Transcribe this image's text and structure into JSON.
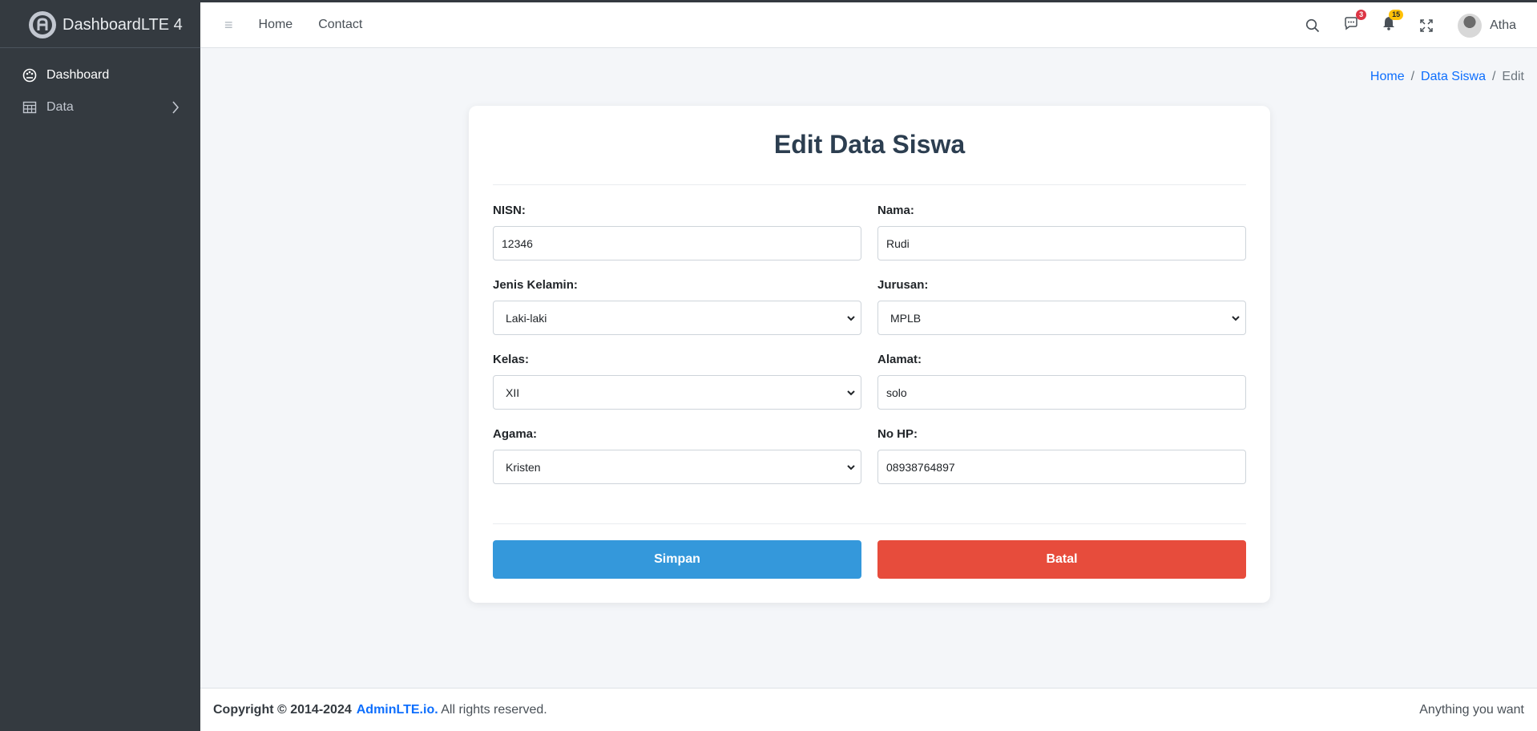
{
  "brand": {
    "name": "DashboardLTE 4"
  },
  "sidebar": {
    "items": [
      {
        "label": "Dashboard",
        "icon": "palette-icon"
      },
      {
        "label": "Data",
        "icon": "table-icon"
      }
    ]
  },
  "topbar": {
    "menu_icon": "≡",
    "links": [
      "Home",
      "Contact"
    ],
    "messages_count": "3",
    "notifications_count": "15",
    "user_name": "Atha"
  },
  "breadcrumb": {
    "home": "Home",
    "data_siswa": "Data Siswa",
    "current": "Edit"
  },
  "form": {
    "title": "Edit Data Siswa",
    "nisn": {
      "label": "NISN:",
      "value": "12346"
    },
    "nama": {
      "label": "Nama:",
      "value": "Rudi"
    },
    "jenis_kelamin": {
      "label": "Jenis Kelamin:",
      "value": "Laki-laki"
    },
    "jurusan": {
      "label": "Jurusan:",
      "value": "MPLB"
    },
    "kelas": {
      "label": "Kelas:",
      "value": "XII"
    },
    "alamat": {
      "label": "Alamat:",
      "value": "solo"
    },
    "agama": {
      "label": "Agama:",
      "value": "Kristen"
    },
    "no_hp": {
      "label": "No HP:",
      "value": "08938764897"
    },
    "save_label": "Simpan",
    "cancel_label": "Batal"
  },
  "footer": {
    "copyright": "Copyright © 2014-2024",
    "link": "AdminLTE.io.",
    "rights": " All rights reserved.",
    "right_text": "Anything you want"
  },
  "colors": {
    "sidebar_bg": "#343a40",
    "primary_link": "#0d6efd",
    "save_button": "#3498db",
    "cancel_button": "#e74c3c",
    "badge_red": "#dc3545",
    "badge_yellow": "#ffc107"
  }
}
